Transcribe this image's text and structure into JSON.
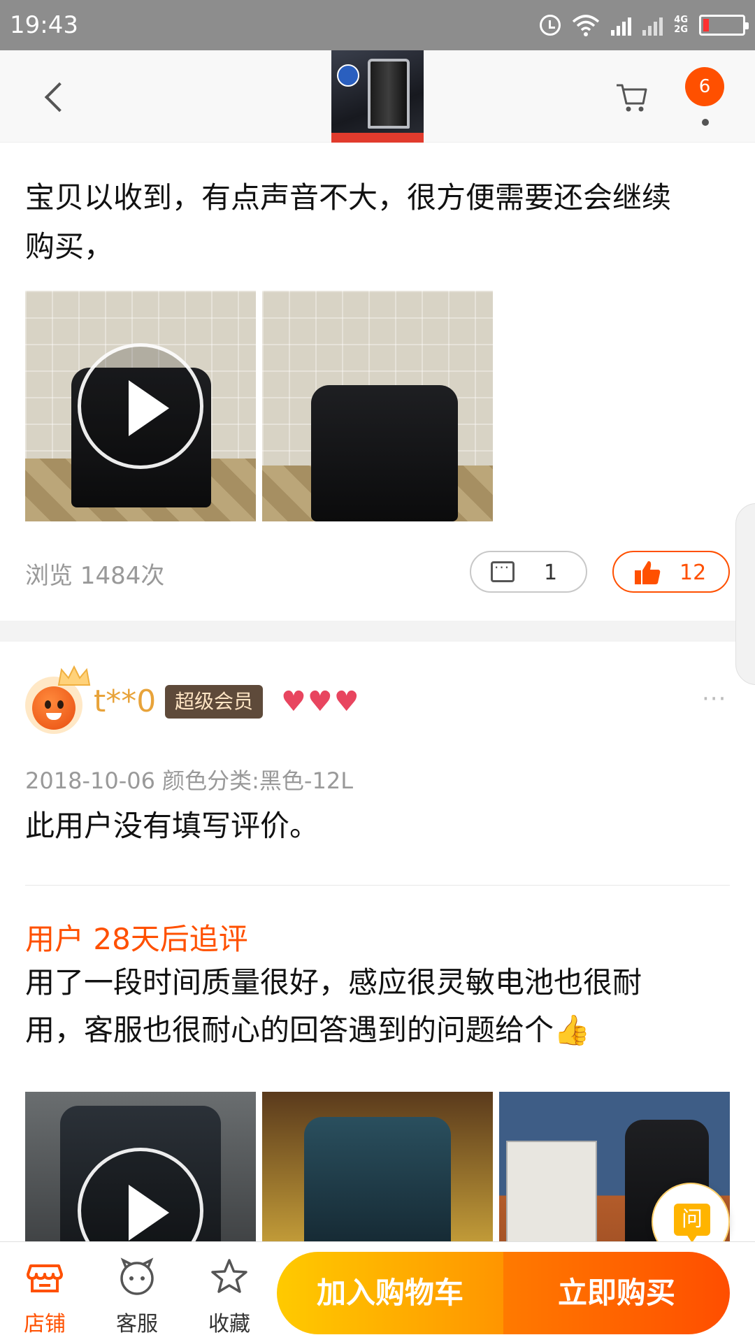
{
  "status_bar": {
    "time": "19:43",
    "network_label_1": "4G",
    "network_label_2": "2G"
  },
  "header": {
    "message_count": "6"
  },
  "review1": {
    "text_line1": "宝贝以收到，有点声音不大，很方便需要还会继续",
    "text_line2": "购买，",
    "views": "浏览 1484次",
    "comment_count": "1",
    "like_count": "12"
  },
  "review2": {
    "username": "t**0",
    "member_tag": "超级会员",
    "meta": "2018-10-06 颜色分类:黑色-12L",
    "text": "此用户没有填写评价。",
    "followup_title": "用户 28天后追评",
    "followup_line1": "用了一段时间质量很好，感应很灵敏电池也很耐",
    "followup_line2": "用，客服也很耐心的回答遇到的问题给个👍"
  },
  "ask_button": {
    "label": "问"
  },
  "bottom_bar": {
    "shop": "店铺",
    "service": "客服",
    "favorite": "收藏",
    "add_to_cart": "加入购物车",
    "buy_now": "立即购买"
  },
  "colors": {
    "accent": "#ff5000",
    "cart_button": "#ffb400",
    "member_tag_bg": "#5e4a3a",
    "username": "#e8a33a"
  }
}
